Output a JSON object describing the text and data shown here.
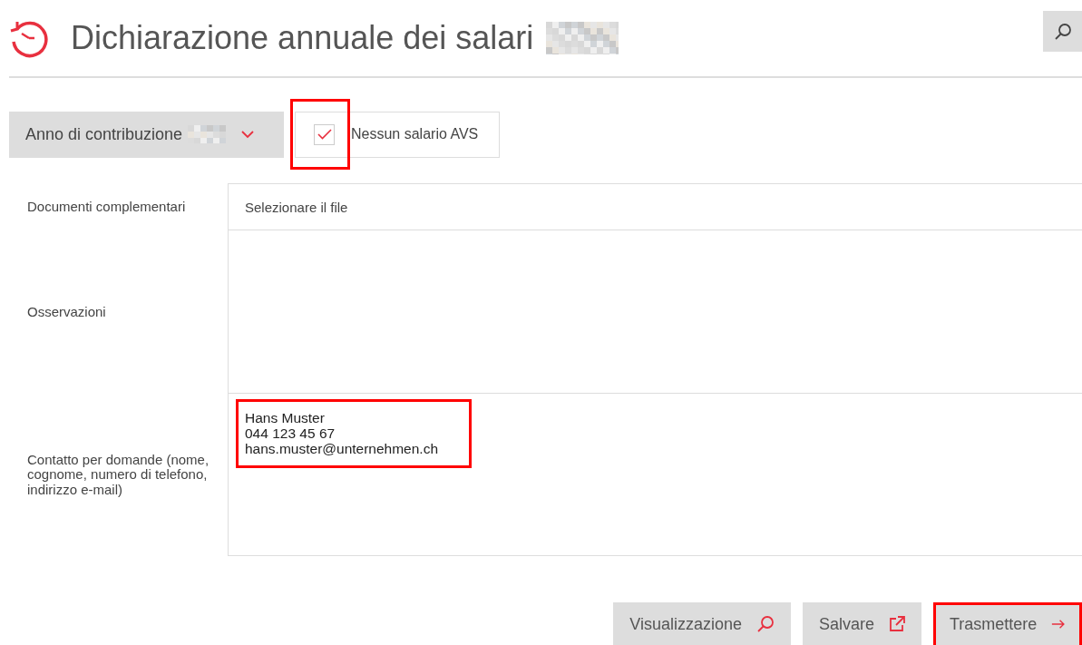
{
  "header": {
    "title": "Dichiarazione annuale dei salari"
  },
  "toolbar": {
    "year_dropdown": {
      "label": "Anno di contribuzione"
    },
    "no_salary_checkbox": {
      "label": "Nessun salario AVS",
      "checked": true,
      "highlighted": true
    }
  },
  "form": {
    "rows": [
      {
        "kind": "file",
        "label": "Documenti complementari",
        "placeholder": "Selezionare il file"
      },
      {
        "kind": "textarea",
        "label": "Osservazioni"
      },
      {
        "kind": "textarea",
        "label": "Contatto per domande (nome, cognome, numero di telefono, indirizzo e-mail)",
        "value": "Hans Muster\n044 123 45 67\nhans.muster@unternehmen.ch",
        "highlighted": true
      }
    ]
  },
  "buttons": [
    {
      "kind": "preview",
      "label": "Visualizzazione",
      "highlighted": false
    },
    {
      "kind": "save",
      "label": "Salvare",
      "highlighted": false
    },
    {
      "kind": "submit",
      "label": "Trasmettere",
      "highlighted": true
    }
  ]
}
